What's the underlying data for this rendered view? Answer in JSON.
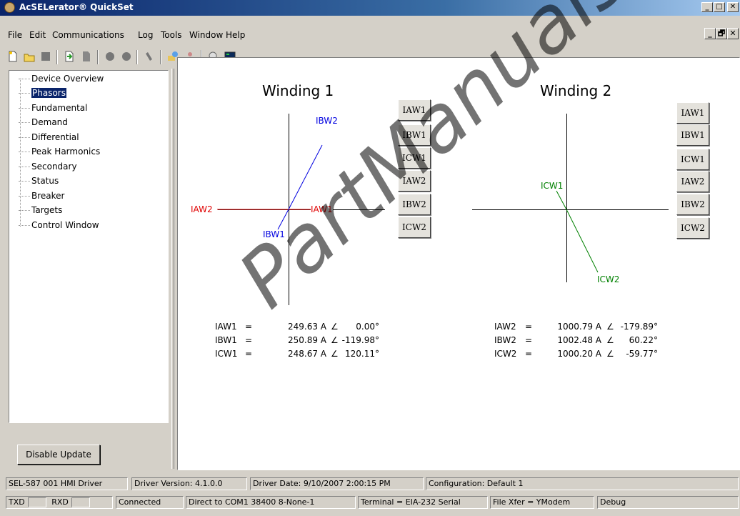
{
  "app": {
    "title": "AcSELerator® QuickSet"
  },
  "title_buttons": [
    "_",
    "□",
    "✕"
  ],
  "mdi_buttons": [
    "_",
    "🗗",
    "✕"
  ],
  "menu": [
    "File",
    "Edit",
    "Communications",
    "Log",
    "Tools",
    "Window",
    "Help"
  ],
  "toolbar_icons": [
    "new-icon",
    "open-icon",
    "save-icon",
    "read-icon",
    "send-icon",
    "connect-icon",
    "disconnect-icon",
    "terminal-icon",
    "settings-icon",
    "user-icon",
    "driver-icon",
    "console-icon"
  ],
  "tree": {
    "items": [
      "Device Overview",
      "Phasors",
      "Fundamental",
      "Demand",
      "Differential",
      "Peak Harmonics",
      "Secondary",
      "Status",
      "Breaker",
      "Targets",
      "Control Window"
    ],
    "selected": "Phasors"
  },
  "disable_update": "Disable Update",
  "phasors": {
    "winding1": {
      "title": "Winding 1",
      "buttons": [
        "IAW1",
        "IBW1",
        "ICW1",
        "IAW2",
        "IBW2",
        "ICW2"
      ],
      "labels": {
        "iaw2": "IAW2",
        "iaw1": "IAW1",
        "ibw2": "IBW2",
        "ibw1": "IBW1"
      },
      "rows": [
        {
          "name": "IAW1",
          "eq": "=",
          "mag": "249.63 A",
          "ang": "∠",
          "deg": "0.00°"
        },
        {
          "name": "IBW1",
          "eq": "=",
          "mag": "250.89 A",
          "ang": "∠",
          "deg": "-119.98°"
        },
        {
          "name": "ICW1",
          "eq": "=",
          "mag": "248.67 A",
          "ang": "∠",
          "deg": "120.11°"
        }
      ]
    },
    "winding2": {
      "title": "Winding 2",
      "buttons": [
        "IAW1",
        "IBW1",
        "ICW1",
        "IAW2",
        "IBW2",
        "ICW2"
      ],
      "labels": {
        "icw1": "ICW1",
        "icw2": "ICW2"
      },
      "rows": [
        {
          "name": "IAW2",
          "eq": "=",
          "mag": "1000.79 A",
          "ang": "∠",
          "deg": "-179.89°"
        },
        {
          "name": "IBW2",
          "eq": "=",
          "mag": "1002.48 A",
          "ang": "∠",
          "deg": "60.22°"
        },
        {
          "name": "ICW2",
          "eq": "=",
          "mag": "1000.20 A",
          "ang": "∠",
          "deg": "-59.77°"
        }
      ]
    },
    "colors": {
      "a": "#e00000",
      "b": "#0000e0",
      "c": "#008000"
    }
  },
  "status1": {
    "driver": "SEL-587 001 HMI Driver",
    "version": "Driver Version: 4.1.0.0",
    "date": "Driver Date: 9/10/2007 2:00:15 PM",
    "config": "Configuration: Default 1"
  },
  "status2": {
    "txd": "TXD",
    "rxd": "RXD",
    "connected": "Connected",
    "port": "Direct to COM1  38400  8-None-1",
    "terminal": "Terminal = EIA-232 Serial",
    "xfer": "File Xfer = YModem",
    "debug": "Debug"
  },
  "watermark": "PartManuals"
}
